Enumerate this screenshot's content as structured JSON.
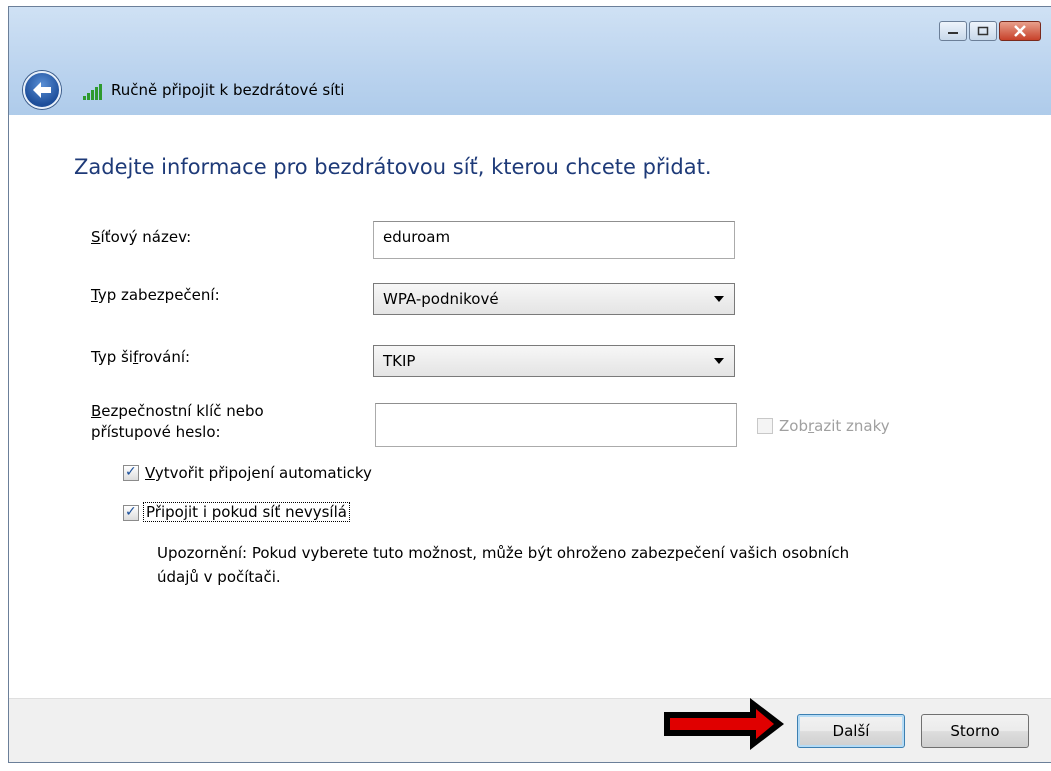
{
  "window": {
    "title": "Ručně připojit k bezdrátové síti"
  },
  "heading": "Zadejte informace pro bezdrátovou síť, kterou chcete přidat.",
  "form": {
    "network_name": {
      "label_first": "S",
      "label_rest": "íťový název:",
      "value": "eduroam"
    },
    "security_type": {
      "label_first": "T",
      "label_rest": "yp zabezpečení:",
      "value": "WPA-podnikové"
    },
    "encryption_type": {
      "label_pre": "Typ ši",
      "label_accel": "f",
      "label_post": "rování:",
      "value": "TKIP"
    },
    "security_key": {
      "label_first": "B",
      "label_line1_rest": "ezpečnostní klíč nebo",
      "label_line2": "přístupové heslo:",
      "value": ""
    },
    "show_chars": {
      "label_pre": "Zob",
      "label_accel": "r",
      "label_post": "azit znaky",
      "checked": false,
      "enabled": false
    },
    "auto_connect": {
      "label_first": "V",
      "label_rest": "ytvořit připojení automaticky",
      "checked": true
    },
    "connect_hidden": {
      "label_pre": "Připo",
      "label_accel": "j",
      "label_post": "it i pokud síť nevysílá",
      "checked": true
    },
    "warning_line1": "Upozornění: Pokud vyberete tuto možnost, může být ohroženo zabezpečení vašich osobních",
    "warning_line2": "údajů v počítači."
  },
  "buttons": {
    "next": "Další",
    "cancel": "Storno"
  },
  "colors": {
    "heading": "#1e3a78",
    "annotation_arrow": "#e00000"
  },
  "icons": [
    "back-arrow-icon",
    "wifi-signal-icon",
    "minimize-icon",
    "maximize-icon",
    "close-icon",
    "checkmark-icon",
    "dropdown-arrow-icon"
  ]
}
